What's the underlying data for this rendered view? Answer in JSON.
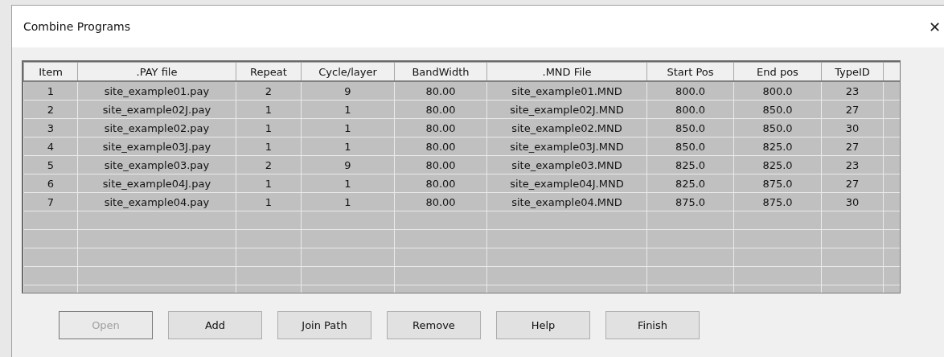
{
  "window": {
    "title": "Combine Programs",
    "close": "✕"
  },
  "table": {
    "columns": [
      "Item",
      ".PAY file",
      "Repeat",
      "Cycle/layer",
      "BandWidth",
      ".MND File",
      "Start Pos",
      "End pos",
      "TypeID"
    ],
    "rows": [
      [
        "1",
        "site_example01.pay",
        "2",
        "9",
        "80.00",
        "site_example01.MND",
        "800.0",
        "800.0",
        "23"
      ],
      [
        "2",
        "site_example02J.pay",
        "1",
        "1",
        "80.00",
        "site_example02J.MND",
        "800.0",
        "850.0",
        "27"
      ],
      [
        "3",
        "site_example02.pay",
        "1",
        "1",
        "80.00",
        "site_example02.MND",
        "850.0",
        "850.0",
        "30"
      ],
      [
        "4",
        "site_example03J.pay",
        "1",
        "1",
        "80.00",
        "site_example03J.MND",
        "850.0",
        "825.0",
        "27"
      ],
      [
        "5",
        "site_example03.pay",
        "2",
        "9",
        "80.00",
        "site_example03.MND",
        "825.0",
        "825.0",
        "23"
      ],
      [
        "6",
        "site_example04J.pay",
        "1",
        "1",
        "80.00",
        "site_example04J.MND",
        "825.0",
        "875.0",
        "27"
      ],
      [
        "7",
        "site_example04.pay",
        "1",
        "1",
        "80.00",
        "site_example04.MND",
        "875.0",
        "875.0",
        "30"
      ]
    ]
  },
  "buttons": [
    {
      "label": "Open",
      "disabled": true
    },
    {
      "label": "Add",
      "disabled": false
    },
    {
      "label": "Join Path",
      "disabled": false
    },
    {
      "label": "Remove",
      "disabled": false
    },
    {
      "label": "Help",
      "disabled": false
    },
    {
      "label": "Finish",
      "disabled": false
    }
  ]
}
